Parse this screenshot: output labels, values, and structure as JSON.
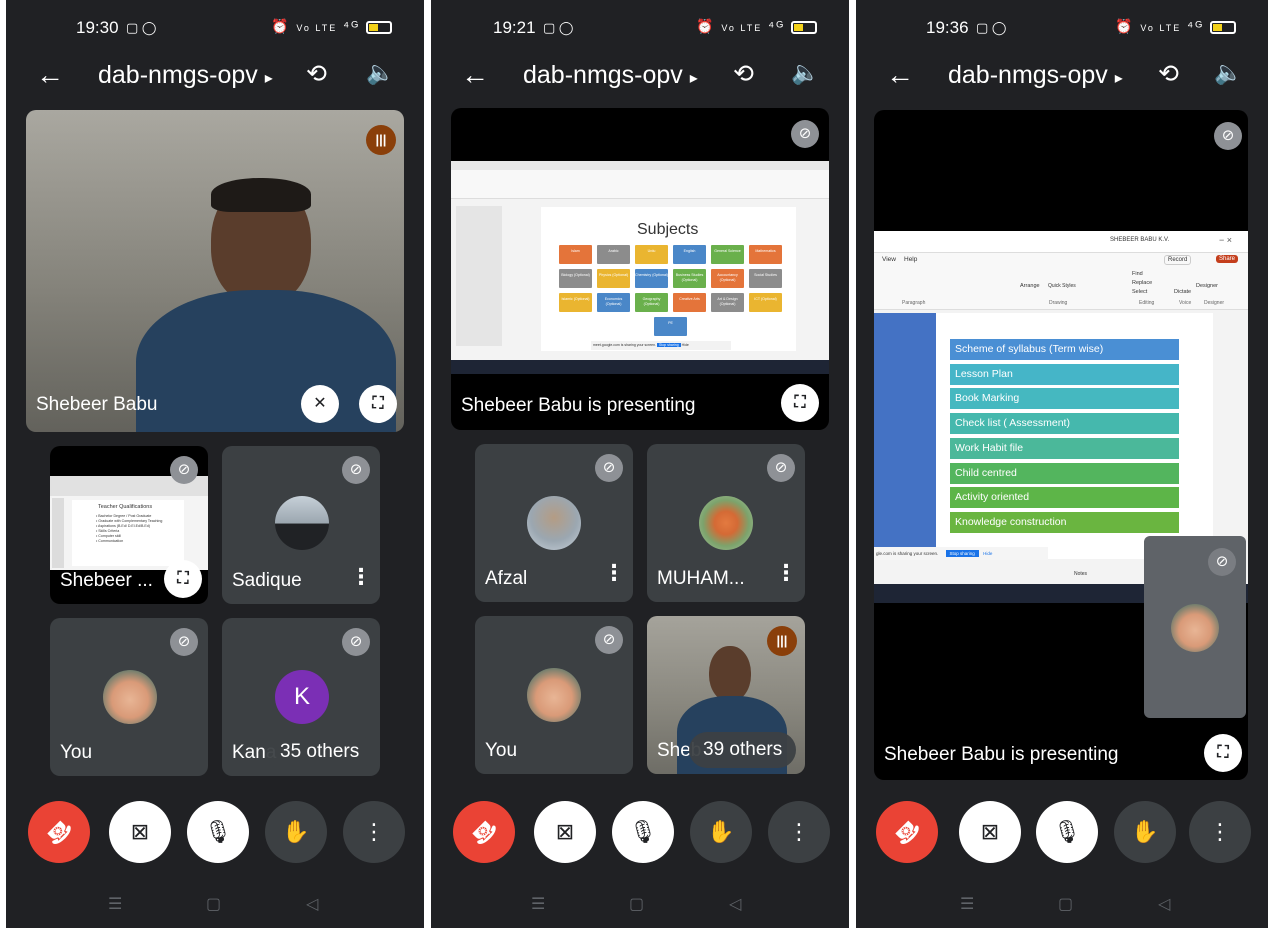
{
  "meeting": {
    "code": "dab-nmgs-opv",
    "code_chevron": "▸",
    "back_icon": "arrow-left-icon",
    "camera_flip_icon": "camera-flip-icon",
    "audio_icon": "speaker-icon"
  },
  "status_icons": {
    "alarm": "⏰",
    "volte": "Vo LTE",
    "signal": "⁴ᴳ"
  },
  "colors": {
    "end_call": "#ea4335",
    "tile_bg": "#3c4043",
    "app_bg": "#202124",
    "speaking": "#8a3f0a",
    "avatar_k": "#7b2fb5"
  },
  "screen1": {
    "time": "19:30",
    "main_tile": {
      "name": "Shebeer Babu"
    },
    "tiles": [
      {
        "name": "Shebeer ...",
        "type": "screen"
      },
      {
        "name": "Sadique",
        "type": "avatar"
      },
      {
        "name": "You",
        "type": "avatar"
      },
      {
        "name": "Kana",
        "type": "letter",
        "letter": "K"
      }
    ],
    "others_count": "35 others",
    "thumb_slide": {
      "title": "Teacher   Qualifications",
      "bullets": [
        "• Bachelor Degree / Post Graduate",
        "• Graduate with Complementary Teaching",
        "• Aspirations (B.Ed/ D.El.Ed/B.Ed)",
        "• Skills Criteria",
        "• Computer skill",
        "• Communication"
      ]
    }
  },
  "screen2": {
    "time": "19:21",
    "presenter_caption": "Shebeer Babu is presenting",
    "slide": {
      "title": "Subjects",
      "subjects": [
        {
          "label": "Islam",
          "color": "#e4743a"
        },
        {
          "label": "Arabic",
          "color": "#8c8c8c"
        },
        {
          "label": "Urdu",
          "color": "#eab530"
        },
        {
          "label": "English",
          "color": "#4a87c8"
        },
        {
          "label": "General Science",
          "color": "#6ab04c"
        },
        {
          "label": "Mathematics",
          "color": "#e4743a"
        },
        {
          "label": "Biology (Optional)",
          "color": "#8c8c8c"
        },
        {
          "label": "Physics (Optional)",
          "color": "#eab530"
        },
        {
          "label": "Chemistry (Optional)",
          "color": "#4a87c8"
        },
        {
          "label": "Business Studies (Optional)",
          "color": "#6ab04c"
        },
        {
          "label": "Accountancy (Optional)",
          "color": "#e4743a"
        },
        {
          "label": "Social Studies",
          "color": "#8c8c8c"
        },
        {
          "label": "Islamic (Optional)",
          "color": "#eab530"
        },
        {
          "label": "Economics (Optional)",
          "color": "#4a87c8"
        },
        {
          "label": "Geography (Optional)",
          "color": "#6ab04c"
        },
        {
          "label": "Creative Arts",
          "color": "#e4743a"
        },
        {
          "label": "Art & Design (Optional)",
          "color": "#8c8c8c"
        },
        {
          "label": "ICT (Optional)",
          "color": "#eab530"
        },
        {
          "label": "PE",
          "color": "#4a87c8"
        }
      ],
      "share_bar": {
        "text": "meet.google.com is sharing your screen.",
        "stop_label": "Stop sharing",
        "hide_label": "Hide"
      }
    },
    "tiles": [
      {
        "name": "Afzal",
        "type": "avatar"
      },
      {
        "name": "MUHAM...",
        "type": "avatar"
      },
      {
        "name": "You",
        "type": "avatar"
      },
      {
        "name": "Sheb",
        "type": "video"
      }
    ],
    "others_count": "39 others"
  },
  "screen3": {
    "time": "19:36",
    "presenter_caption": "Shebeer Babu is presenting",
    "ribbon": {
      "user": "SHEBEER BABU K.V.",
      "menu": [
        "View",
        "Help"
      ],
      "record_label": "Record",
      "share_label": "Share",
      "groups": [
        "Paragraph",
        "Drawing",
        "Editing",
        "Voice",
        "Designer"
      ],
      "tools": [
        "Find",
        "Replace",
        "Select",
        "Dictate",
        "Designer",
        "Arrange",
        "Quick Styles"
      ]
    },
    "syllabus_items": [
      {
        "label": "Scheme of syllabus (Term wise)",
        "color": "#4a8fd4"
      },
      {
        "label": "Lesson Plan",
        "color": "#45b5c8"
      },
      {
        "label": "Book Marking",
        "color": "#45b8c0"
      },
      {
        "label": "Check list ( Assessment)",
        "color": "#45b8ad"
      },
      {
        "label": "Work Habit file",
        "color": "#4bb89a"
      },
      {
        "label": "Child centred",
        "color": "#53b55e"
      },
      {
        "label": "Activity oriented",
        "color": "#5db548"
      },
      {
        "label": "Knowledge construction",
        "color": "#6ab540"
      }
    ],
    "share_bar": {
      "text": "gle.com is sharing your screen.",
      "stop_label": "Stop sharing",
      "hide_label": "Hide"
    },
    "notes_label": "Notes"
  },
  "controls": [
    {
      "name": "end-call",
      "icon": "phone-hangup-icon",
      "glyph": "☎"
    },
    {
      "name": "camera",
      "icon": "camera-off-icon",
      "glyph": "⊠"
    },
    {
      "name": "microphone",
      "icon": "mic-off-icon",
      "glyph": "🎙"
    },
    {
      "name": "raise-hand",
      "icon": "hand-icon",
      "glyph": "✋"
    },
    {
      "name": "more",
      "icon": "more-vertical-icon",
      "glyph": "⋮"
    }
  ],
  "nav": {
    "menu": "☰",
    "home": "▢",
    "back": "◁"
  }
}
